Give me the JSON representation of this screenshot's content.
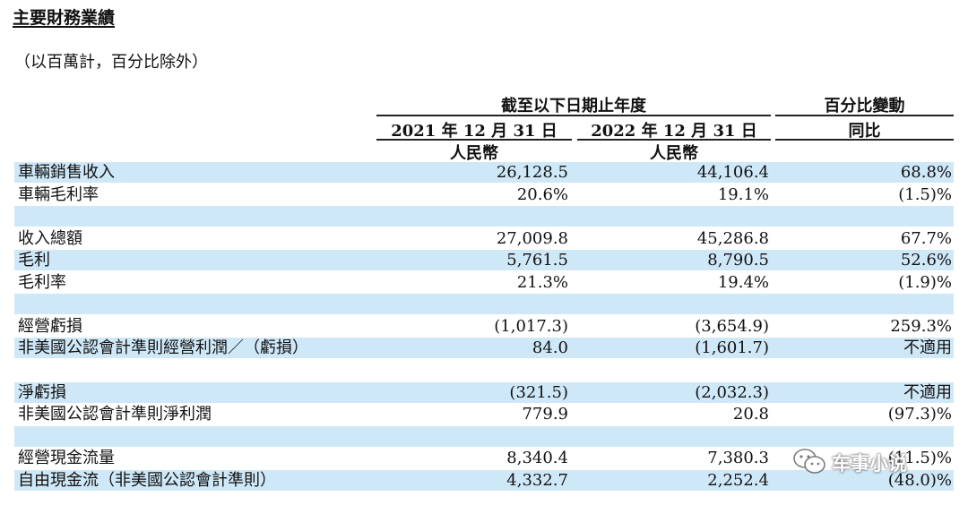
{
  "title": "主要財務業績",
  "subtitle": "（以百萬計，百分比除外）",
  "header": {
    "period_group": "截至以下日期止年度",
    "col1_date": "2021 年 12 月 31 日",
    "col2_date": "2022 年 12 月 31 日",
    "col1_unit": "人民幣",
    "col2_unit": "人民幣",
    "change_group": "百分比變動",
    "change_sub": "同比"
  },
  "rows": [
    {
      "label": "車輛銷售收入",
      "y2021": "26,128.5",
      "y2022": "44,106.4",
      "change": "68.8%"
    },
    {
      "label": "車輛毛利率",
      "y2021": "20.6%",
      "y2022": "19.1%",
      "change": "(1.5)%"
    },
    {
      "label": "",
      "y2021": "",
      "y2022": "",
      "change": ""
    },
    {
      "label": "收入總額",
      "y2021": "27,009.8",
      "y2022": "45,286.8",
      "change": "67.7%"
    },
    {
      "label": "毛利",
      "y2021": "5,761.5",
      "y2022": "8,790.5",
      "change": "52.6%"
    },
    {
      "label": "毛利率",
      "y2021": "21.3%",
      "y2022": "19.4%",
      "change": "(1.9)%"
    },
    {
      "label": "",
      "y2021": "",
      "y2022": "",
      "change": ""
    },
    {
      "label": "經營虧損",
      "y2021": "(1,017.3)",
      "y2022": "(3,654.9)",
      "change": "259.3%"
    },
    {
      "label": "非美國公認會計準則經營利潤／（虧損）",
      "y2021": "84.0",
      "y2022": "(1,601.7)",
      "change": "不適用"
    },
    {
      "label": "",
      "y2021": "",
      "y2022": "",
      "change": ""
    },
    {
      "label": "淨虧損",
      "y2021": "(321.5)",
      "y2022": "(2,032.3)",
      "change": "不適用"
    },
    {
      "label": "非美國公認會計準則淨利潤",
      "y2021": "779.9",
      "y2022": "20.8",
      "change": "(97.3)%"
    },
    {
      "label": "",
      "y2021": "",
      "y2022": "",
      "change": ""
    },
    {
      "label": "經營現金流量",
      "y2021": "8,340.4",
      "y2022": "7,380.3",
      "change": "(11.5)%"
    },
    {
      "label": "自由現金流（非美國公認會計準則）",
      "y2021": "4,332.7",
      "y2022": "2,252.4",
      "change": "(48.0)%"
    }
  ],
  "watermark": {
    "text": "车事小说",
    "icon": "wechat-icon"
  }
}
